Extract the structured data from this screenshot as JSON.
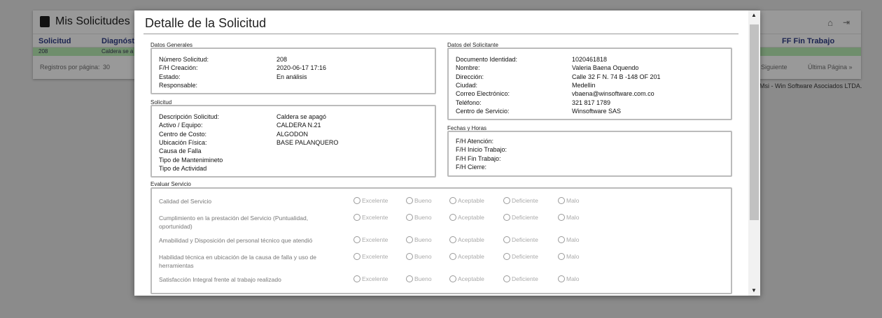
{
  "background": {
    "title": "Mis Solicitudes",
    "columns": [
      "Solicitud",
      "Diagnóstic",
      "FF Fin Trabajo"
    ],
    "row": [
      "208",
      "Caldera se a"
    ],
    "per_page_label": "Registros por página:",
    "per_page": "30",
    "next": "Siguiente",
    "last": "Última Página »",
    "copyright": "Msi - Win Software Asociados LTDA."
  },
  "modal": {
    "title": "Detalle de la Solicitud",
    "generales": {
      "title": "Datos Generales",
      "rows": [
        [
          "Número Solicitud:",
          "208"
        ],
        [
          "F/H Creación:",
          "2020-06-17 17:16"
        ],
        [
          "Estado:",
          "En análisis"
        ],
        [
          "Responsable:",
          ""
        ]
      ]
    },
    "solicitud": {
      "title": "Solicitud",
      "rows": [
        [
          "Descripción Solicitud:",
          "Caldera se apagó"
        ],
        [
          "Activo / Equipo:",
          "CALDERA N.21"
        ],
        [
          "Centro de Costo:",
          "ALGODON"
        ],
        [
          "Ubicación Física:",
          "BASE PALANQUERO"
        ],
        [
          "Causa de Falla",
          ""
        ],
        [
          "Tipo de Mantenimineto",
          ""
        ],
        [
          "Tipo de Actividad",
          ""
        ]
      ]
    },
    "solicitante": {
      "title": "Datos del Solicitante",
      "rows": [
        [
          "Documento Identidad:",
          "1020461818"
        ],
        [
          "Nombre:",
          "Valeria Baena Oquendo"
        ],
        [
          "Dirección:",
          "Calle 32 F N. 74 B -148 OF 201"
        ],
        [
          "Ciudad:",
          "Medellin"
        ],
        [
          "Correo Electrónico:",
          "vbaena@winsoftware.com.co"
        ],
        [
          "Teléfono:",
          "321 817 1789"
        ],
        [
          "Centro de Servicio:",
          "Winsoftware SAS"
        ]
      ]
    },
    "fechas": {
      "title": "Fechas y Horas",
      "rows": [
        "F/H Atención:",
        "F/H Inicio Trabajo:",
        "F/H Fin Trabajo:",
        "F/H Cierre:"
      ]
    },
    "evaluar": {
      "title": "Evaluar Servicio",
      "options": [
        "Excelente",
        "Bueno",
        "Aceptable",
        "Deficiente",
        "Malo"
      ],
      "questions": [
        "Calidad del Servicio",
        "Cumplimiento en la prestación del Servicio (Puntualidad, oportunidad)",
        "Amabilidad y Disposición del personal técnico que atendió",
        "Habilidad técnica en ubicación de la causa de falla y uso de herramientas",
        "Satisfacción Integral frente al trabajo realizado"
      ]
    }
  }
}
